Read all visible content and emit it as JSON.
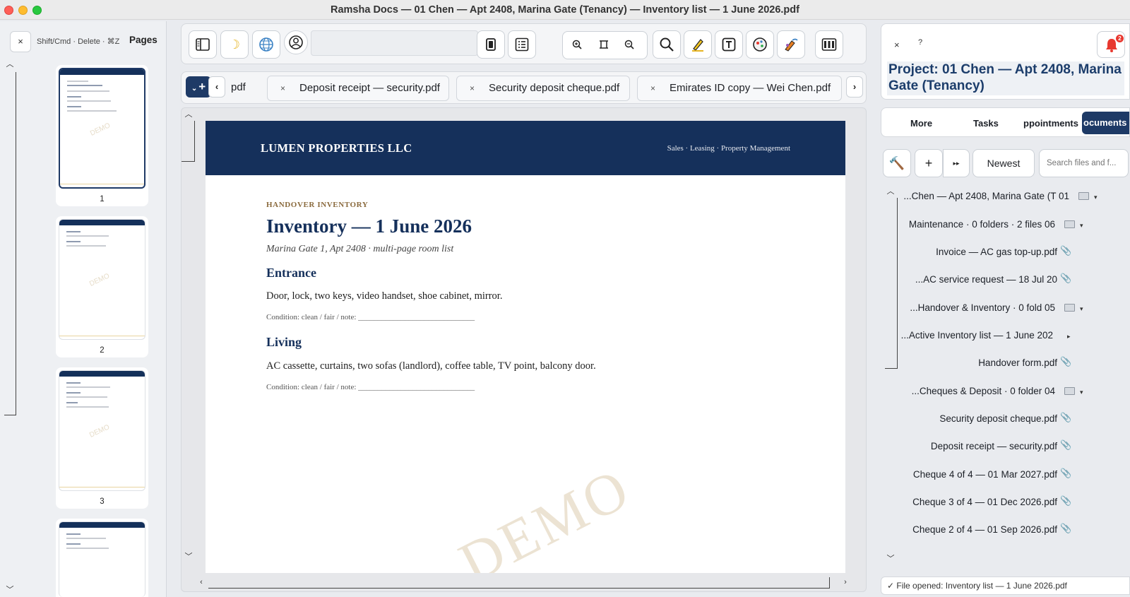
{
  "window": {
    "title": "Ramsha Docs — 01 Chen — Apt 2408, Marina Gate (Tenancy) — Inventory list — 1 June 2026.pdf"
  },
  "pages_panel": {
    "close": "×",
    "hint": "Shift/Cmd · Delete · ⌘Z",
    "title": "Pages",
    "thumbnails": [
      {
        "number": "1",
        "selected": true
      },
      {
        "number": "2",
        "selected": false
      },
      {
        "number": "3",
        "selected": false
      },
      {
        "number": "",
        "selected": false
      }
    ]
  },
  "toolbar": {
    "icons": [
      "sidebar-toggle-icon",
      "dark-mode-icon",
      "globe-icon",
      "account-icon",
      "file-icon",
      "checklist-icon",
      "zoom-in-icon",
      "fit-page-icon",
      "zoom-out-icon",
      "search-icon",
      "highlight-icon",
      "text-box-icon",
      "stamp-icon",
      "sign-icon",
      "compare-icon"
    ],
    "input_value": ""
  },
  "tabs": {
    "add": "+",
    "add_caret": "⌄",
    "prev": "‹",
    "next": "›",
    "items": [
      {
        "label": "pdf",
        "closable": false
      },
      {
        "label": "Deposit receipt — security.pdf",
        "close": "×"
      },
      {
        "label": "Security deposit cheque.pdf",
        "close": "×"
      },
      {
        "label": "Emirates ID copy — Wei Chen.pdf",
        "close": "×"
      }
    ]
  },
  "document": {
    "company": "LUMEN PROPERTIES LLC",
    "tagline": "Sales · Leasing · Property Management",
    "kicker": "HANDOVER INVENTORY",
    "title": "Inventory — 1 June 2026",
    "subtitle": "Marina Gate 1, Apt 2408 · multi-page room list",
    "sections": [
      {
        "heading": "Entrance",
        "body": "Door, lock, two keys, video handset, shoe cabinet, mirror.",
        "condition": "Condition: clean / fair / note: ______________________________"
      },
      {
        "heading": "Living",
        "body": "AC cassette, curtains, two sofas (landlord), coffee table, TV point, balcony door.",
        "condition": "Condition: clean / fair / note: ______________________________"
      }
    ],
    "watermark": "DEMO",
    "thumb_watermark": "DEMO"
  },
  "right_panel": {
    "close": "×",
    "help": "?",
    "notifications_badge": "2",
    "project_title": "Project: 01 Chen — Apt 2408, Marina Gate (Tenancy)",
    "tabs": [
      {
        "label": "More",
        "active": false
      },
      {
        "label": "Tasks",
        "active": false
      },
      {
        "label": "ppointments",
        "active": false
      },
      {
        "label": "ocuments ·",
        "active": true
      }
    ],
    "tools": {
      "hammer": "🔨",
      "add": "+",
      "more": "▸▸",
      "sort": "Newest",
      "search_placeholder": "Search files and f..."
    },
    "files": [
      {
        "label": "...Chen — Apt 2408, Marina Gate (T 01",
        "kind": "folder",
        "caret": "▾"
      },
      {
        "label": "Maintenance  ·  0 folders · 2 files 06",
        "kind": "folder",
        "caret": "▾"
      },
      {
        "label": "Invoice — AC gas top-up.pdf",
        "kind": "file"
      },
      {
        "label": "...AC service request — 18 Jul 20",
        "kind": "file"
      },
      {
        "label": "...Handover & Inventory  ·  0 fold 05",
        "kind": "folder",
        "caret": "▾"
      },
      {
        "label": "...Active Inventory list — 1 June 202",
        "kind": "active",
        "caret": "▸"
      },
      {
        "label": "Handover form.pdf",
        "kind": "file"
      },
      {
        "label": "...Cheques & Deposit  ·  0 folder 04",
        "kind": "folder",
        "caret": "▾"
      },
      {
        "label": "Security deposit cheque.pdf",
        "kind": "file"
      },
      {
        "label": "Deposit receipt — security.pdf",
        "kind": "file"
      },
      {
        "label": "Cheque 4 of 4 — 01 Mar 2027.pdf",
        "kind": "file"
      },
      {
        "label": "Cheque 3 of 4 — 01 Dec 2026.pdf",
        "kind": "file"
      },
      {
        "label": "Cheque 2 of 4 — 01 Sep 2026.pdf",
        "kind": "file"
      }
    ],
    "status": "✓ File opened: Inventory list — 1 June 2026.pdf"
  },
  "colors": {
    "brand_navy": "#15305b",
    "accent_gold": "#8a6a3d",
    "notify_red": "#e8382f",
    "tab_active": "#1e3a66"
  }
}
